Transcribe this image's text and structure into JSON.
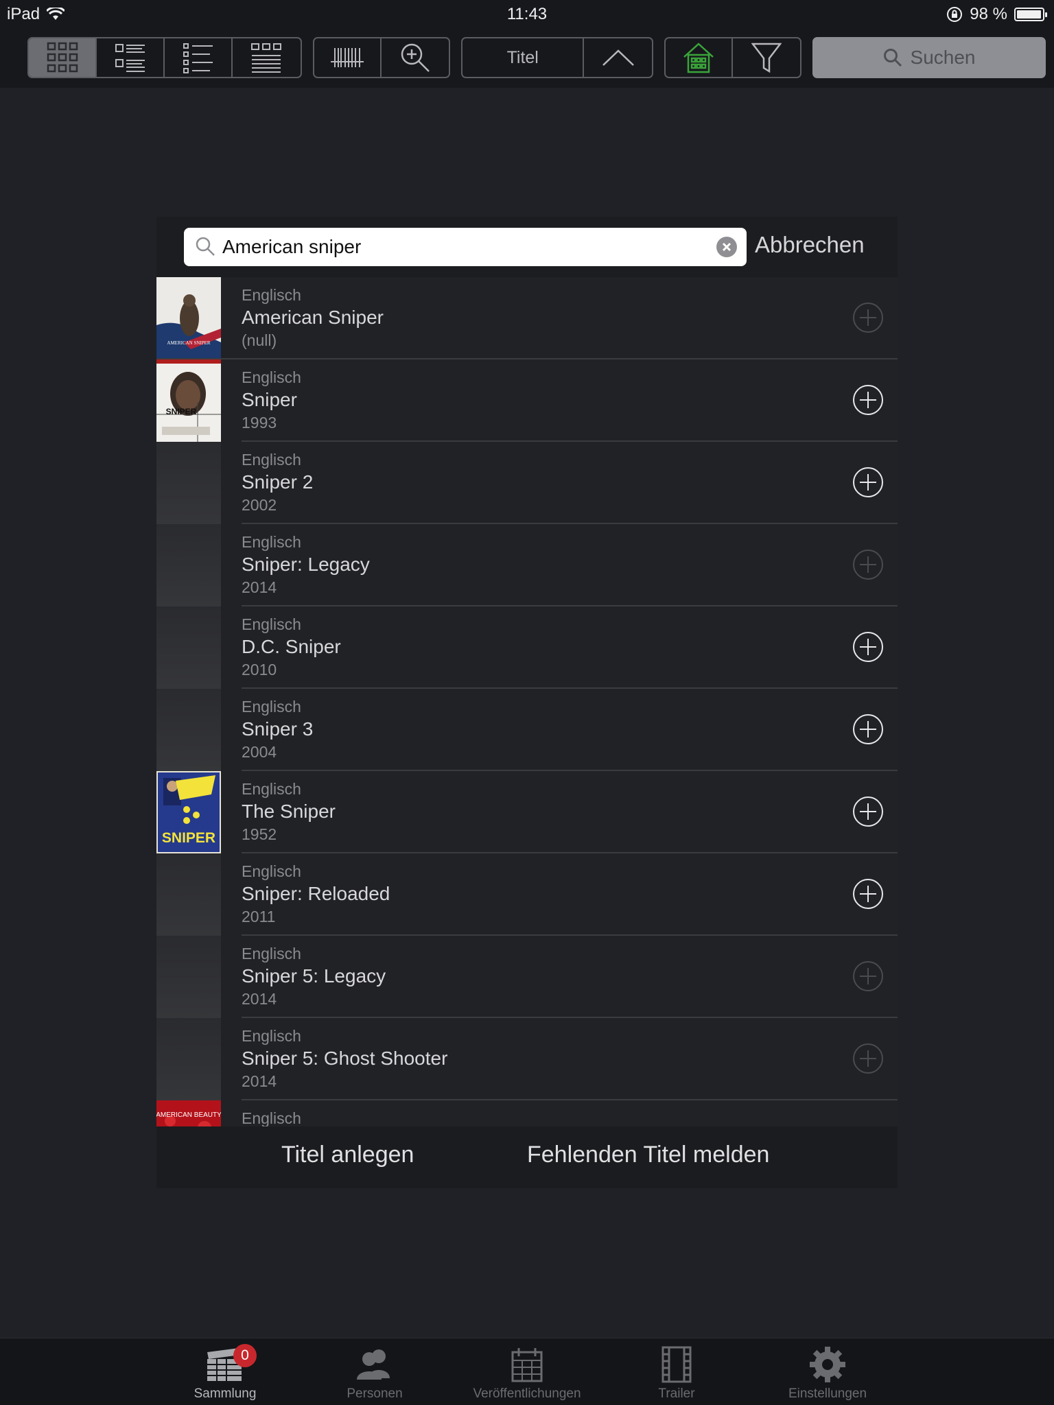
{
  "status_bar": {
    "device": "iPad",
    "time": "11:43",
    "battery": "98 %",
    "battery_level": 0.98
  },
  "toolbar": {
    "sort_label": "Titel",
    "search_label": "Suchen"
  },
  "search": {
    "query": "American sniper",
    "cancel_label": "Abbrechen"
  },
  "results": [
    {
      "language": "Englisch",
      "title": "American Sniper",
      "year": "(null)",
      "add_enabled": false,
      "poster": "american-sniper"
    },
    {
      "language": "Englisch",
      "title": "Sniper",
      "year": "1993",
      "add_enabled": true,
      "poster": "sniper-1993"
    },
    {
      "language": "Englisch",
      "title": "Sniper 2",
      "year": "2002",
      "add_enabled": true,
      "poster": ""
    },
    {
      "language": "Englisch",
      "title": "Sniper: Legacy",
      "year": "2014",
      "add_enabled": false,
      "poster": ""
    },
    {
      "language": "Englisch",
      "title": "D.C. Sniper",
      "year": "2010",
      "add_enabled": true,
      "poster": ""
    },
    {
      "language": "Englisch",
      "title": "Sniper 3",
      "year": "2004",
      "add_enabled": true,
      "poster": ""
    },
    {
      "language": "Englisch",
      "title": "The Sniper",
      "year": "1952",
      "add_enabled": true,
      "poster": "the-sniper-1952"
    },
    {
      "language": "Englisch",
      "title": "Sniper: Reloaded",
      "year": "2011",
      "add_enabled": true,
      "poster": ""
    },
    {
      "language": "Englisch",
      "title": "Sniper 5: Legacy",
      "year": "2014",
      "add_enabled": false,
      "poster": ""
    },
    {
      "language": "Englisch",
      "title": "Sniper 5: Ghost Shooter",
      "year": "2014",
      "add_enabled": false,
      "poster": ""
    },
    {
      "language": "Englisch",
      "title": "",
      "year": "",
      "add_enabled": false,
      "poster": "american-beauty"
    }
  ],
  "poster_texts": {
    "american_sniper": "AMERICAN SNIPER",
    "sniper_1993": "SNIPER",
    "the_sniper": "SNIPER",
    "american_beauty": "AMERICAN BEAUTY"
  },
  "footer": {
    "create_label": "Titel anlegen",
    "report_label": "Fehlenden Titel melden"
  },
  "tabbar": {
    "items": [
      {
        "label": "Sammlung",
        "badge": "0",
        "active": true
      },
      {
        "label": "Personen"
      },
      {
        "label": "Veröffentlichungen"
      },
      {
        "label": "Trailer"
      },
      {
        "label": "Einstellungen"
      }
    ]
  },
  "colors": {
    "background": "#1f2126",
    "toolbar": "#17181c",
    "home_icon": "#3aa53a",
    "badge": "#c8282d"
  }
}
